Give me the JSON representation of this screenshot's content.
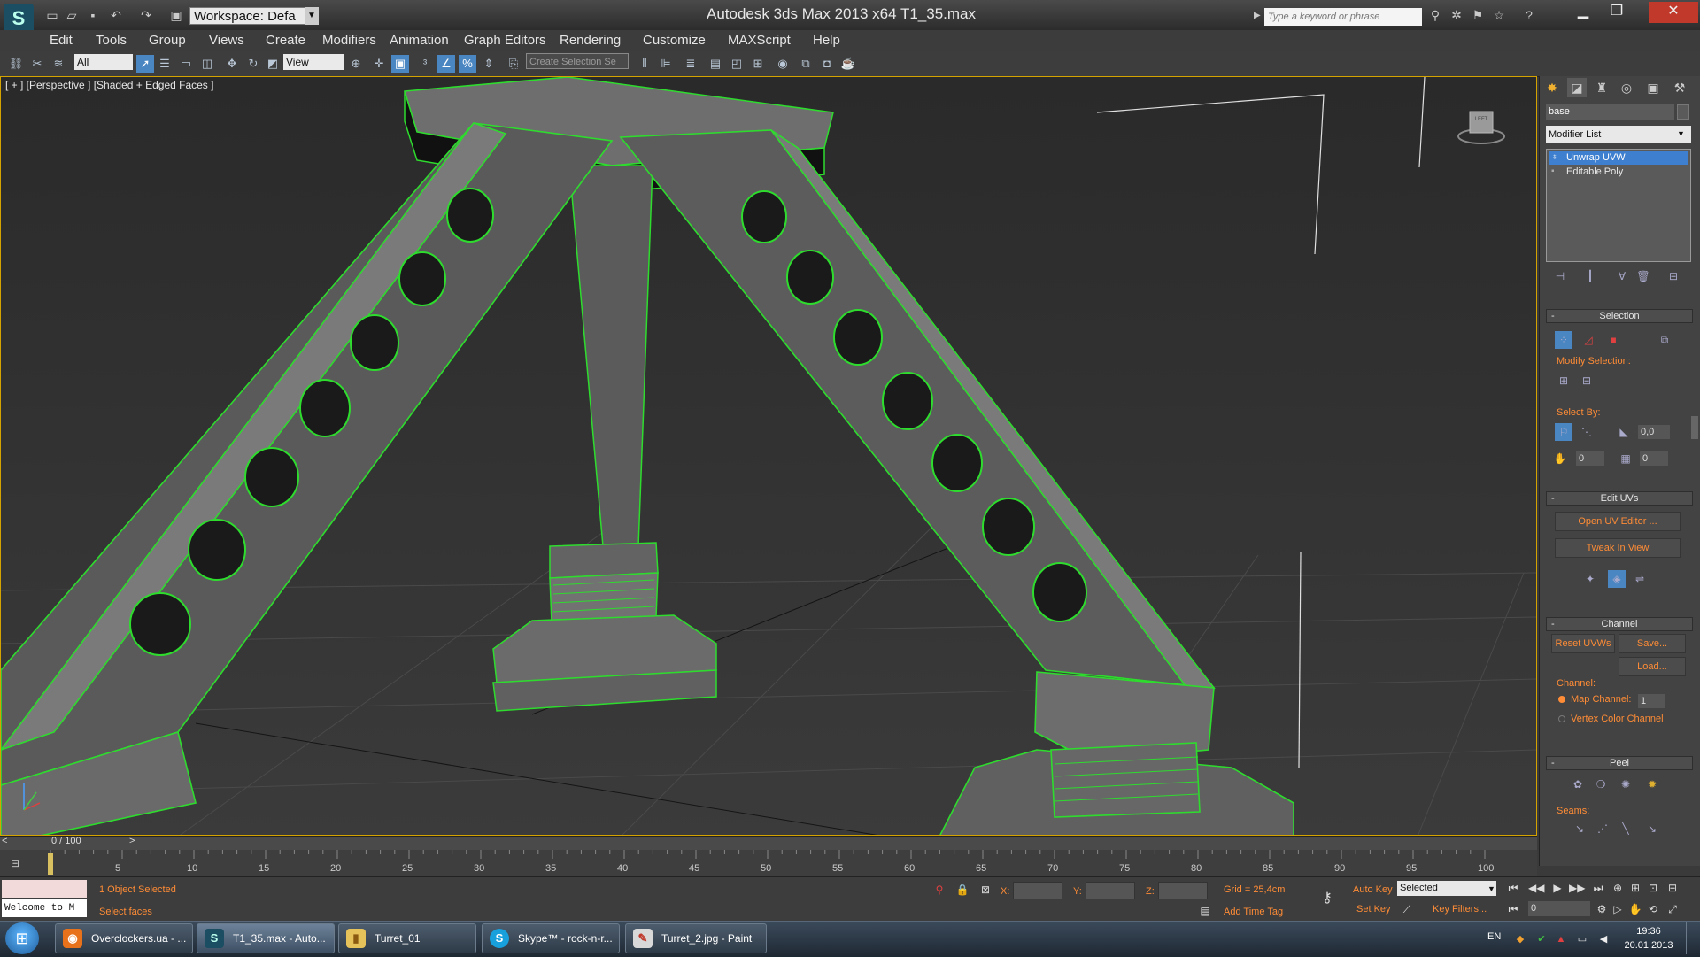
{
  "titlebar": {
    "workspace": "Workspace: Defa",
    "title": "Autodesk 3ds Max  2013 x64     T1_35.max",
    "search_placeholder": "Type a keyword or phrase"
  },
  "menu": [
    "Edit",
    "Tools",
    "Group",
    "Views",
    "Create",
    "Modifiers",
    "Animation",
    "Graph Editors",
    "Rendering",
    "Customize",
    "MAXScript",
    "Help"
  ],
  "toolbar": {
    "selection_filter": "All",
    "ref_coord": "View",
    "named_selection": "Create Selection Se"
  },
  "viewport": {
    "label": "[ + ] [Perspective ] [Shaded + Edged Faces ]",
    "viewcube_face": "LEFT"
  },
  "command_panel": {
    "object_name": "base",
    "modifier_list": "Modifier List",
    "stack": [
      "Unwrap UVW",
      "Editable Poly"
    ],
    "selection": {
      "title": "Selection",
      "modify_selection": "Modify Selection:",
      "select_by": "Select By:",
      "angle_value": "0,0",
      "spin_a": "0",
      "spin_b": "0"
    },
    "edit_uvs": {
      "title": "Edit UVs",
      "open_uv_editor": "Open UV Editor ...",
      "tweak_in_view": "Tweak In View"
    },
    "channel": {
      "title": "Channel",
      "reset_uvws": "Reset UVWs",
      "save": "Save...",
      "load": "Load...",
      "channel_label": "Channel:",
      "map_channel": "Map Channel:",
      "map_channel_value": "1",
      "vertex_color_channel": "Vertex Color Channel"
    },
    "peel": {
      "title": "Peel",
      "seams": "Seams:"
    }
  },
  "timeline": {
    "frame_display": "0 / 100",
    "ticks": [
      "5",
      "10",
      "15",
      "20",
      "25",
      "30",
      "35",
      "40",
      "45",
      "50",
      "55",
      "60",
      "65",
      "70",
      "75",
      "80",
      "85",
      "90",
      "95",
      "100"
    ]
  },
  "status": {
    "listener_text": "Welcome to M",
    "objects_selected": "1 Object Selected",
    "prompt": "Select faces",
    "x_label": "X:",
    "y_label": "Y:",
    "z_label": "Z:",
    "grid": "Grid = 25,4cm",
    "add_time_tag": "Add Time Tag",
    "auto_key": "Auto Key",
    "set_key": "Set Key",
    "key_mode": "Selected",
    "key_filters": "Key Filters...",
    "frame_value": "0"
  },
  "taskbar": {
    "apps": [
      {
        "label": "Overclockers.ua - ...",
        "icon": "firefox-icon"
      },
      {
        "label": "T1_35.max - Auto...",
        "icon": "3dsmax-icon"
      },
      {
        "label": "Turret_01",
        "icon": "folder-icon"
      },
      {
        "label": "Skype™ - rock-n-r...",
        "icon": "skype-icon"
      },
      {
        "label": "Turret_2.jpg - Paint",
        "icon": "paint-icon"
      }
    ],
    "lang": "EN",
    "time": "19:36",
    "date": "20.01.2013"
  },
  "colors": {
    "accent_orange": "#ff8c36",
    "wire_green": "#2edc2e",
    "viewport_border": "#d4a300",
    "highlight_blue": "#3f7fcf"
  }
}
